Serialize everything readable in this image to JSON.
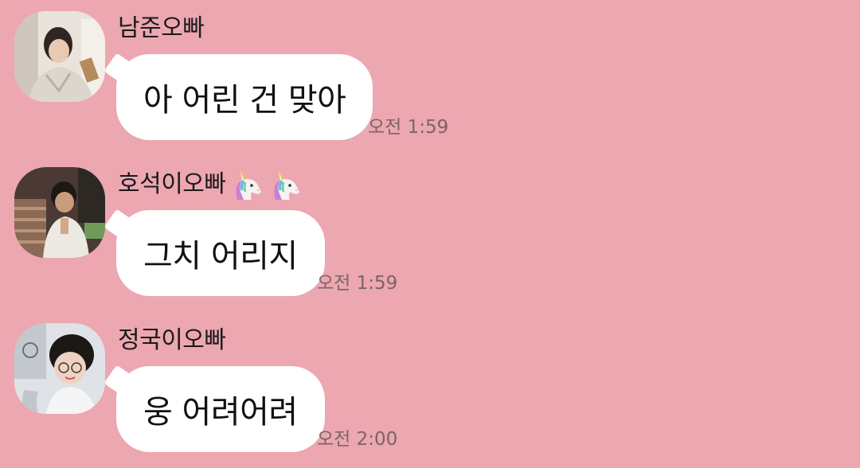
{
  "messages": [
    {
      "sender": "남준오빠",
      "sender_emoji": [],
      "text": "아 어린 건 맞아",
      "time": "오전 1:59",
      "avatar_icon": "avatar-namjoon-photo"
    },
    {
      "sender": "호석이오빠",
      "sender_emoji": [
        "unicorn-icon",
        "unicorn-icon"
      ],
      "text": "그치 어리지",
      "time": "오전 1:59",
      "avatar_icon": "avatar-hoseok-photo"
    },
    {
      "sender": "정국이오빠",
      "sender_emoji": [],
      "text": "웅 어려어려",
      "time": "오전 2:00",
      "avatar_icon": "avatar-jungkook-photo"
    }
  ],
  "colors": {
    "background": "#eca7b1",
    "bubble": "#ffffff",
    "timestamp": "#7a6468"
  }
}
